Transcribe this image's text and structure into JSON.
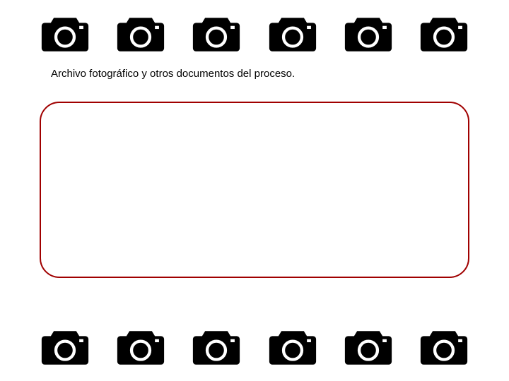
{
  "caption": "Archivo fotográfico y otros documentos del proceso.",
  "icons": {
    "top_count": 6,
    "bottom_count": 6,
    "name": "camera-icon"
  },
  "frame": {
    "border_color": "#a00000"
  }
}
